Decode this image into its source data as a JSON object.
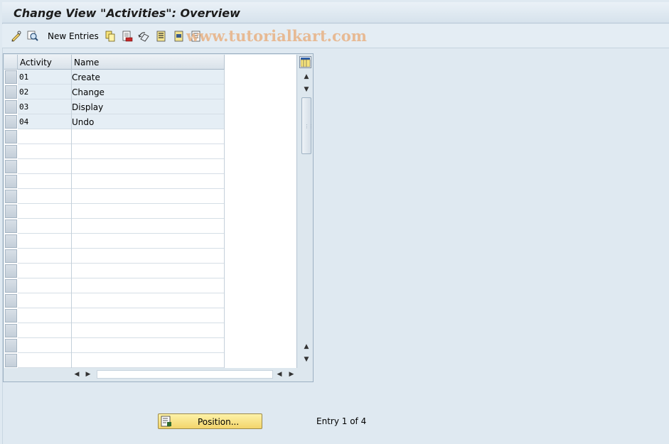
{
  "window": {
    "title": "Change View \"Activities\": Overview"
  },
  "toolbar": {
    "new_entries_label": "New Entries",
    "icons": [
      "display-change-icon",
      "details-icon",
      "copy-icon",
      "delete-icon",
      "undo-icon",
      "select-all-icon",
      "select-block-icon",
      "deselect-all-icon"
    ]
  },
  "watermark": "www.tutorialkart.com",
  "table": {
    "columns": [
      "Activity",
      "Name"
    ],
    "rows": [
      {
        "activity": "01",
        "name": "Create"
      },
      {
        "activity": "02",
        "name": "Change"
      },
      {
        "activity": "03",
        "name": "Display"
      },
      {
        "activity": "04",
        "name": "Undo"
      }
    ]
  },
  "footer": {
    "position_label": "Position...",
    "entry_text": "Entry 1 of 4"
  },
  "colors": {
    "background": "#dfe9f1",
    "row_fill": "#e5eef5",
    "button_yellow": "#f3d56b",
    "watermark": "#e8b58a"
  }
}
